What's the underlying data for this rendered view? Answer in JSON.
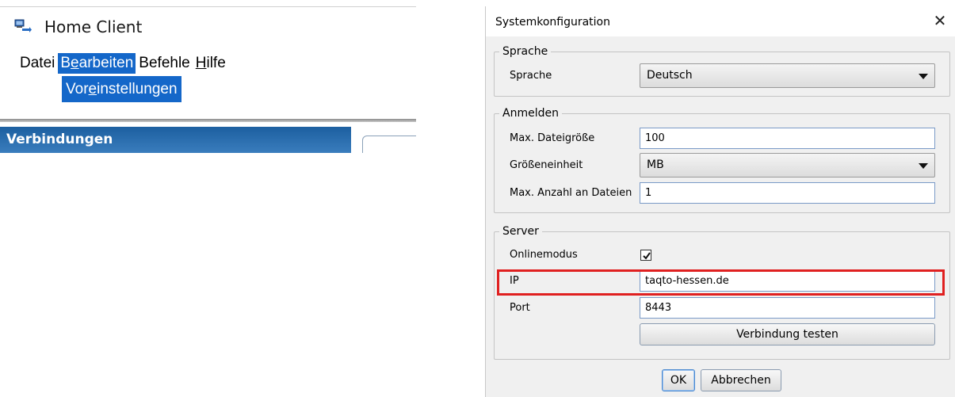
{
  "home_client": {
    "title": "Home Client",
    "app_icon": "home-client-app-icon",
    "menu": [
      {
        "label": "Datei",
        "active": false
      },
      {
        "label_pre": "B",
        "label_ul": "e",
        "label_post": "arbeiten",
        "active": true
      },
      {
        "label": "Befehle",
        "active": false
      },
      {
        "label_ul": "H",
        "label_post": "ilfe",
        "active": false
      }
    ],
    "submenu": {
      "label_pre": "Vor",
      "label_ul": "e",
      "label_post": "instellungen"
    },
    "connections_header": "Verbindungen"
  },
  "dialog": {
    "title": "Systemkonfiguration",
    "close_icon": "close-icon",
    "groups": {
      "sprache": {
        "legend": "Sprache",
        "label": "Sprache",
        "value": "Deutsch"
      },
      "anmelden": {
        "legend": "Anmelden",
        "max_size_label": "Max. Dateigröße",
        "max_size_value": "100",
        "unit_label": "Größeneinheit",
        "unit_value": "MB",
        "max_files_label": "Max. Anzahl an Dateien",
        "max_files_value": "1"
      },
      "server": {
        "legend": "Server",
        "online_label": "Onlinemodus",
        "online_checked": true,
        "ip_label": "IP",
        "ip_value": "taqto-hessen.de",
        "port_label": "Port",
        "port_value": "8443",
        "test_button": "Verbindung testen"
      }
    },
    "buttons": {
      "ok": "OK",
      "cancel": "Abbrechen"
    },
    "highlight_color": "#e02020"
  }
}
